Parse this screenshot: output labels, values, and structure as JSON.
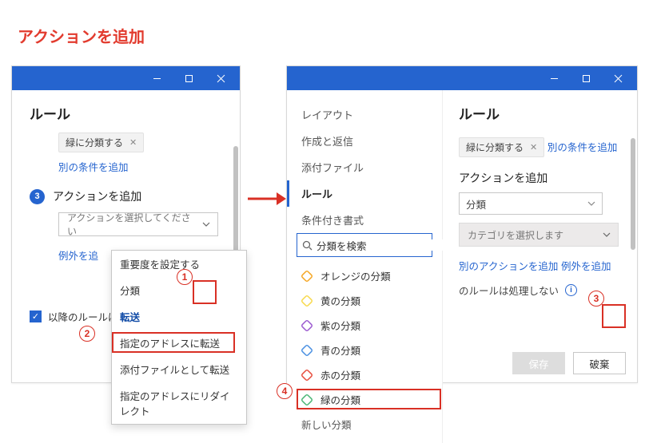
{
  "page_heading": "アクションを追加",
  "colors": {
    "brand": "#2564cf",
    "red": "#d93025"
  },
  "pane1": {
    "title": "ルール",
    "chip_text": "緑に分類する",
    "add_condition": "別の条件を追加",
    "step_num": "3",
    "step_label": "アクションを追加",
    "placeholder": "アクションを選択してください",
    "exception_link": "例外を追",
    "checkbox_label": "以降のルールは",
    "dropdown": {
      "group1_header": "重要度を設定する",
      "item1": "分類",
      "group2_header": "転送",
      "item2": "指定のアドレスに転送",
      "item3": "添付ファイルとして転送",
      "item4": "指定のアドレスにリダイレクト"
    }
  },
  "pane2": {
    "title": "ルール",
    "sidebar": {
      "layout": "レイアウト",
      "compose": "作成と返信",
      "attach": "添付ファイル",
      "rules": "ルール",
      "cond": "条件付き書式"
    },
    "search_value": "分類を検索",
    "colors": [
      {
        "name": "オレンジの分類",
        "fill": "#f5a623"
      },
      {
        "name": "黄の分類",
        "fill": "#f7d94c"
      },
      {
        "name": "紫の分類",
        "fill": "#9b59d0"
      },
      {
        "name": "青の分類",
        "fill": "#4a90e2"
      },
      {
        "name": "赤の分類",
        "fill": "#e74c3c"
      },
      {
        "name": "緑の分類",
        "fill": "#49b675"
      }
    ],
    "new_cat": "新しい分類",
    "chip_text": "緑に分類する",
    "add_condition": "別の条件を追加",
    "step_label": "アクションを追加",
    "select_value": "分類",
    "category_placeholder": "カテゴリを選択します",
    "add_action": "別のアクションを追加",
    "add_exception": "例外を追加",
    "final_rule": "のルールは処理しない",
    "save": "保存",
    "discard": "破棄"
  }
}
